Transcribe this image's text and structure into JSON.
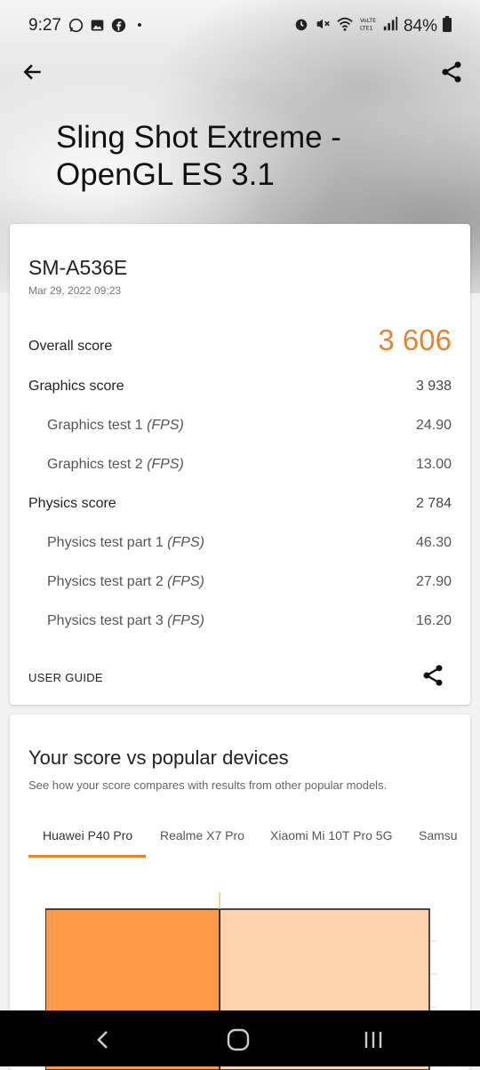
{
  "status_bar": {
    "time": "9:27",
    "dot": "•",
    "battery": "84%",
    "icons": [
      "whatsapp-icon",
      "gallery-icon",
      "facebook-icon",
      "alarm-icon",
      "mute-icon",
      "wifi-icon",
      "volte-icon",
      "signal-icon",
      "battery-icon"
    ]
  },
  "header": {
    "title": "Sling Shot Extreme - OpenGL ES 3.1"
  },
  "result": {
    "device": "SM-A536E",
    "date": "Mar 29, 2022 09:23",
    "overall_label": "Overall score",
    "overall_value": "3 606",
    "graphics_label": "Graphics score",
    "graphics_value": "3 938",
    "gt1_label": "Graphics test 1",
    "gt1_unit": "(FPS)",
    "gt1_value": "24.90",
    "gt2_label": "Graphics test 2",
    "gt2_unit": "(FPS)",
    "gt2_value": "13.00",
    "physics_label": "Physics score",
    "physics_value": "2 784",
    "pt1_label": "Physics test part 1",
    "pt1_unit": "(FPS)",
    "pt1_value": "46.30",
    "pt2_label": "Physics test part 2",
    "pt2_unit": "(FPS)",
    "pt2_value": "27.90",
    "pt3_label": "Physics test part 3",
    "pt3_unit": "(FPS)",
    "pt3_value": "16.20",
    "user_guide": "USER GUIDE"
  },
  "compare": {
    "title": "Your score vs popular devices",
    "subtitle": "See how your score compares with results from other popular models.",
    "tabs": [
      "Huawei P40 Pro",
      "Realme X7 Pro",
      "Xiaomi Mi 10T Pro 5G",
      "Samsu"
    ],
    "active_tab": 0
  },
  "colors": {
    "accent": "#e8822b",
    "bar_own": "#ff9a4a",
    "bar_other": "#fdd2ad"
  }
}
